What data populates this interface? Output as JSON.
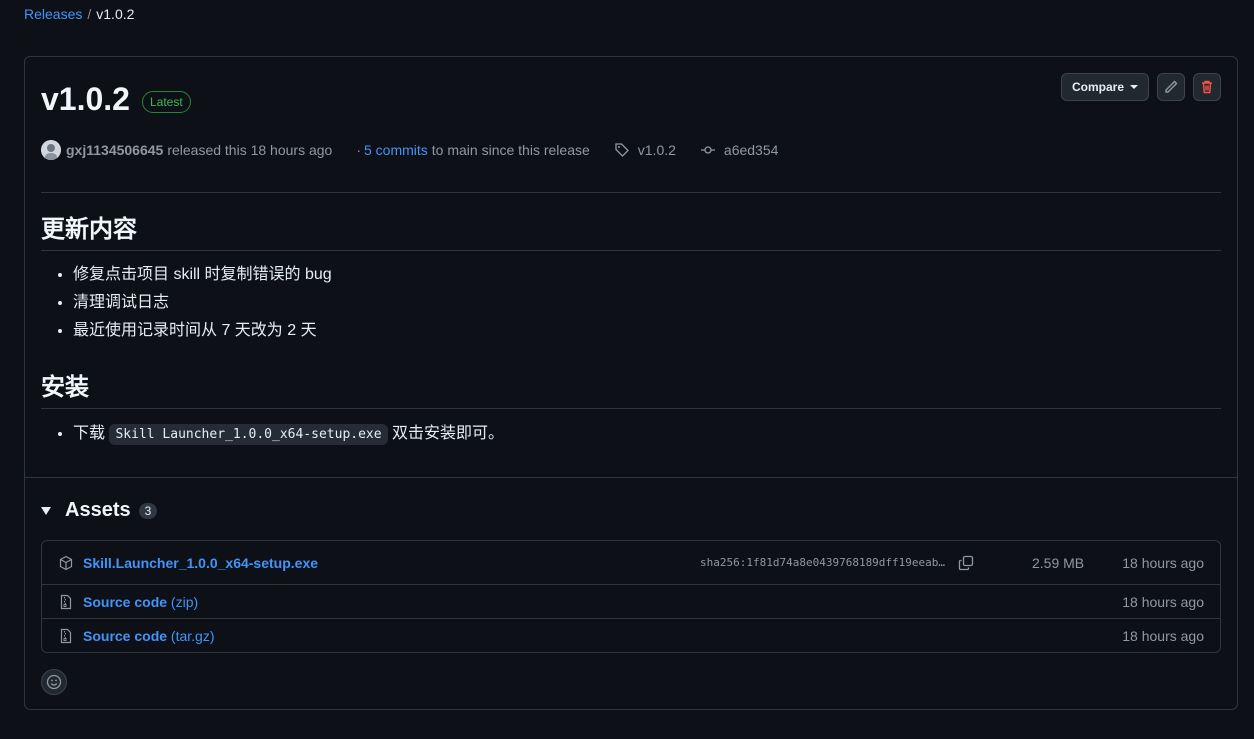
{
  "breadcrumb": {
    "releases": "Releases",
    "separator": "/",
    "current": "v1.0.2"
  },
  "release": {
    "title": "v1.0.2",
    "badge": "Latest",
    "compare_label": "Compare",
    "edit_icon": "pencil-icon",
    "delete_icon": "trash-icon",
    "author": "gxj1134506645",
    "released_text": "released this 18 hours ago",
    "commits_prefix": "·",
    "commits_link": "5 commits",
    "commits_suffix": "to main since this release",
    "tag": "v1.0.2",
    "commit": "a6ed354"
  },
  "notes": {
    "heading1": "更新内容",
    "items1": [
      "修复点击项目 skill 时复制错误的 bug",
      "清理调试日志",
      "最近使用记录时间从 7 天改为 2 天"
    ],
    "heading2": "安装",
    "install_prefix": "下载",
    "install_file": "Skill Launcher_1.0.0_x64-setup.exe",
    "install_suffix": "双击安装即可。"
  },
  "assets": {
    "label": "Assets",
    "count": "3",
    "items": [
      {
        "name": "Skill.Launcher_1.0.0_x64-setup.exe",
        "sha": "sha256:1f81d74a8e0439768189dff19eeab…",
        "size": "2.59 MB",
        "date": "18 hours ago",
        "icon": "package-icon"
      },
      {
        "name": "Source code",
        "suffix": "(zip)",
        "date": "18 hours ago",
        "icon": "file-zip-icon"
      },
      {
        "name": "Source code",
        "suffix": "(tar.gz)",
        "date": "18 hours ago",
        "icon": "file-zip-icon"
      }
    ]
  },
  "colors": {
    "bg": "#0d1117",
    "link": "#4493f8",
    "latest": "#3fb950",
    "delete": "#f85149"
  }
}
